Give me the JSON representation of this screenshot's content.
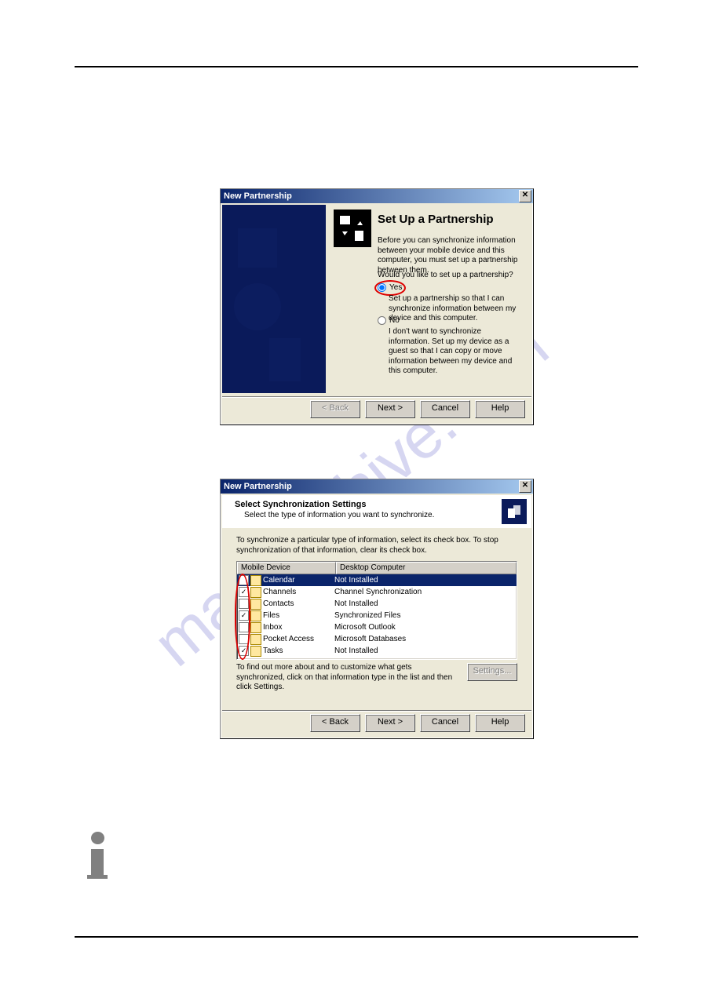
{
  "watermark": "manualshive.com",
  "dialog1": {
    "title": "New Partnership",
    "heading": "Set Up a Partnership",
    "intro": "Before you can synchronize information between your mobile device and this computer, you must set up a partnership between them.",
    "question": "Would you like to set up a partnership?",
    "yes_label": "Yes",
    "yes_desc": "Set up a partnership so that I can synchronize information between my device and this computer.",
    "no_label": "No",
    "no_desc": "I don't want to synchronize information. Set up my device as a guest so that I can copy or move information between my device and this computer.",
    "back": "< Back",
    "next": "Next >",
    "cancel": "Cancel",
    "help": "Help"
  },
  "dialog2": {
    "title": "New Partnership",
    "header_title": "Select Synchronization Settings",
    "header_sub": "Select the type of information you want to synchronize.",
    "instr": "To synchronize a particular type of information, select its check box. To stop synchronization of that information, clear its check box.",
    "col1": "Mobile Device",
    "col2": "Desktop Computer",
    "rows": [
      {
        "checked": false,
        "name": "Calendar",
        "desktop": "Not Installed",
        "selected": true
      },
      {
        "checked": true,
        "name": "Channels",
        "desktop": "Channel Synchronization",
        "selected": false
      },
      {
        "checked": false,
        "name": "Contacts",
        "desktop": "Not Installed",
        "selected": false
      },
      {
        "checked": true,
        "name": "Files",
        "desktop": "Synchronized Files",
        "selected": false
      },
      {
        "checked": false,
        "name": "Inbox",
        "desktop": "Microsoft Outlook",
        "selected": false
      },
      {
        "checked": false,
        "name": "Pocket Access",
        "desktop": "Microsoft Databases",
        "selected": false
      },
      {
        "checked": true,
        "name": "Tasks",
        "desktop": "Not Installed",
        "selected": false
      }
    ],
    "footer": "To find out more about and to customize what gets synchronized, click on that information type in the list and then click Settings.",
    "settings": "Settings...",
    "back": "< Back",
    "next": "Next >",
    "cancel": "Cancel",
    "help": "Help"
  }
}
